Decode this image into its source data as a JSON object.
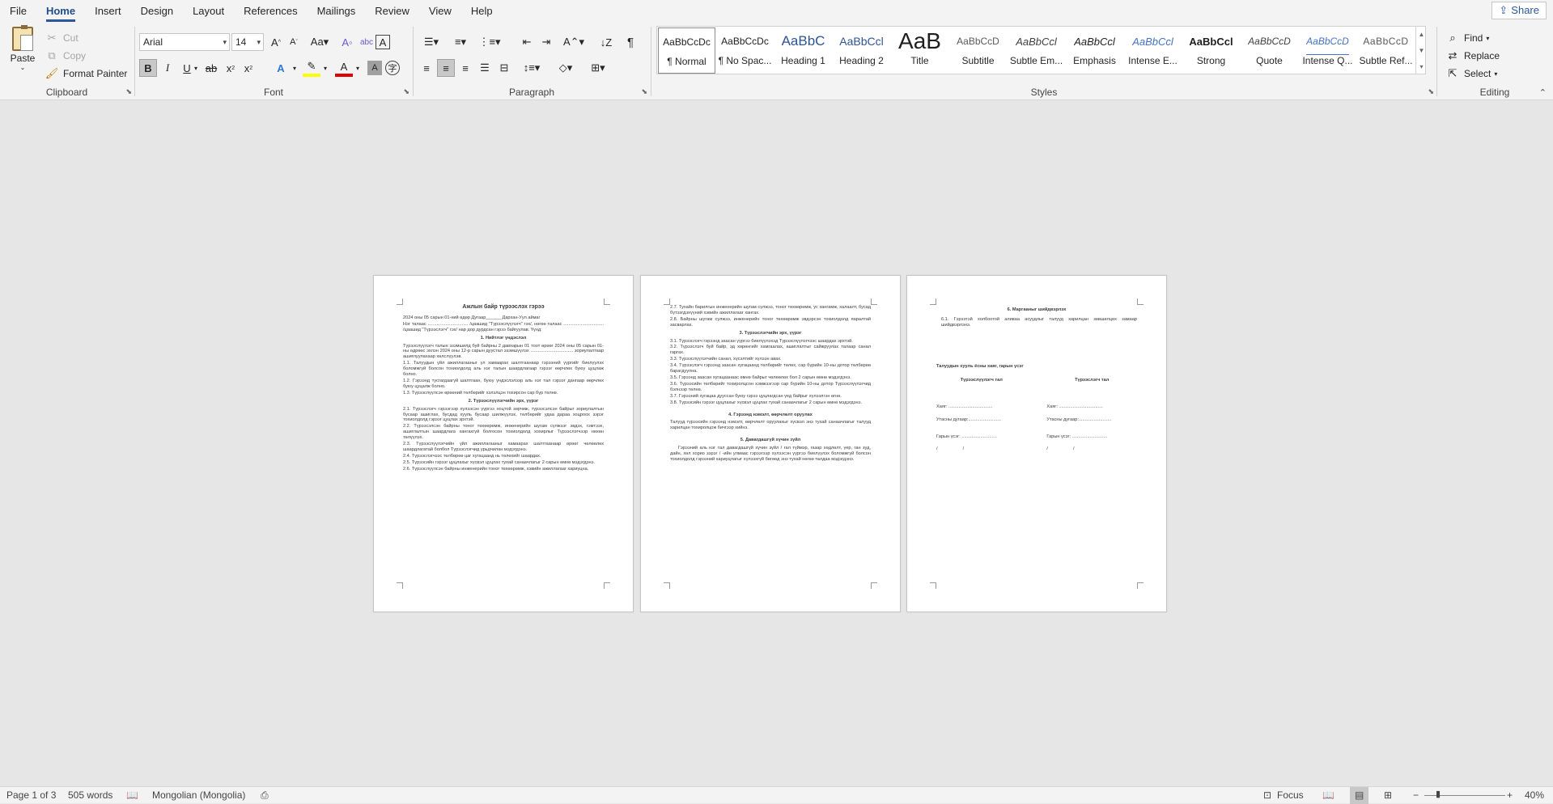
{
  "menu": {
    "tabs": [
      "File",
      "Home",
      "Insert",
      "Design",
      "Layout",
      "References",
      "Mailings",
      "Review",
      "View",
      "Help"
    ],
    "share": "Share"
  },
  "clipboard": {
    "paste": "Paste",
    "cut": "Cut",
    "copy": "Copy",
    "format_painter": "Format Painter",
    "label": "Clipboard"
  },
  "font": {
    "name": "Arial",
    "size": "14",
    "label": "Font"
  },
  "paragraph": {
    "label": "Paragraph"
  },
  "styles": {
    "label": "Styles",
    "items": [
      {
        "preview": "AaBbCcDc",
        "name": "¶ Normal"
      },
      {
        "preview": "AaBbCcDc",
        "name": "¶ No Spac..."
      },
      {
        "preview": "AaBbC",
        "name": "Heading 1"
      },
      {
        "preview": "AaBbCcl",
        "name": "Heading 2"
      },
      {
        "preview": "AaB",
        "name": "Title"
      },
      {
        "preview": "AaBbCcD",
        "name": "Subtitle"
      },
      {
        "preview": "AaBbCcl",
        "name": "Subtle Em..."
      },
      {
        "preview": "AaBbCcl",
        "name": "Emphasis"
      },
      {
        "preview": "AaBbCcl",
        "name": "Intense E..."
      },
      {
        "preview": "AaBbCcl",
        "name": "Strong"
      },
      {
        "preview": "AaBbCcD",
        "name": "Quote"
      },
      {
        "preview": "AaBbCcD",
        "name": "Intense Q..."
      },
      {
        "preview": "AaBbCcD",
        "name": "Subtle Ref..."
      }
    ]
  },
  "editing": {
    "find": "Find",
    "replace": "Replace",
    "select": "Select",
    "label": "Editing"
  },
  "pages": {
    "p1": {
      "title": "Ажлын байр түрээслэх гэрээ",
      "intro": "2024 оны 05 сарын 01-ний өдөр Дугаар______ Дархан-Уул аймаг",
      "para1": "Нэг талаас ................................ /цаашид \"Түрээслүүлэгч\" гэх/, нөгөө талаас ................................ /цаашид \"Түрээслэгч\" гэх/ нар дор дурдсан гэрээ байгуулав. Үүнд:",
      "h1": "1.  Нийтлэг үндэслэл",
      "s1": "Түрээслүүлэгч талын эзэмшилд буй байрны 2 давхарын 01 тоот өрөөг 2024 оны 05 сарын 01-ны өдрөөс эхлэн 2024 оны 12-р сарын дуустал эзэмшүүлэх .................................. зориулалтаар ашиглуулахаар хөлслүүлэв.",
      "s1_1": "1.1.  Талуудын үйл ажиллагааныг үл хамаарах шалтгаанаар гэрээний үүргийг биелүүлэх боломжгүй болсон тохиолдолд аль нэг талын шаардлагаар гэрээг өөрчлөх буюу цуцлаж болно.",
      "s1_2": "1.2.  Гэрээнд тусгагдаагүй шалтгаан, буюу үндэслэлээр аль нэг тал гэрээг дангаар өөрчлөх буюу цуцалж болно.",
      "s1_3": "1.3.  Түрээслүүлсэн өрөөний төлбөрийг хэлэлцэн тохирсон сар бүр төлнө.",
      "h2": "2.  Түрээслүүлэгчийн эрх, үүрэг",
      "s2_1": "2.1.  Түрээслэгч гэрээгээр хүлээсэн үүргээ ноцтой зөрчиж, түрээсэлсэн байрыг зориулалтын бусаар ашиглах, бусдад хууль бусаар шилжүүлэх, төлбөрийг удаа дараа хоцроох зэрэг тохиолдолд гэрээг цуцлах эрхтэй.",
      "s2_2": "2.2.  Түрээсэлсэн байрны тоног төхөөрөмж, инженерийн шугам сүлжээг эвдэх, гэмтээх, ашиглалтын шаардлага хангахгүй болгосон тохиолдолд хохирлыг Түрээслэгчээр нөхөн төлүүлэх.",
      "s2_3": "2.3.  Түрээслүүлэгчийн үйл ажиллагааныг хамаарах шалтгаанаар өрөөг чөлөөлөх шаардлагатай болбол Түрээслэгчид урьдчилан мэдэгдэнэ.",
      "s2_4": "2.4.  Түрээслэгчээс төлбөрөө цаг хугацаанд нь төлөхийг шаардах.",
      "s2_5": "2.5.  Түрээсийн гэрээг цуцлахыг хүсвэл цуцлах тухай санаачлагыг 2 сарын өмнө мэдэгдэнэ.",
      "s2_6": "2.6.  Түрээслүүлсэн байрны инженерийн тоног төхөөрөмж, хэвийн ажиллагааг хариуцна."
    },
    "p2": {
      "s2_7": "2.7. Тухайн барилгын инженерийн шугам сүлжээ, тоног төхөөрөмж, ус хангамж, халаалт, бусад бүтээгдэхүүний хэвийн ажиллагааг хангах.",
      "s2_8": "2.8. Байрны шугам сүлжээ, инженерийн тоног төхөөрөмж эвдэрсэн тохиолдолд яаралтай засварлах.",
      "h3": "3.  Түрээслэгчийн эрх, үүрэг",
      "s3_1": "3.1. Түрээслэгч гэрээнд заасан үүргээ биелүүлэхэд Түрээслүүлэгчээс шаардах эрхтэй.",
      "s3_2": "3.2. Түрээслэгч буй байр, эд хөрөнгийг хамгаалах, ашиглалтыг сайжруулах талаар санал гаргах.",
      "s3_3": "3.3. Түрээслүүлэгчийн санал, хүсэлтийг хүлээн авах.",
      "s3_4": "3.4. Түрээслэгч гэрээнд заасан хугацаанд төлбөрийг төлөх, сар бүрийн 10-ны дотор төлбөрөө барагдуулна.",
      "s3_5": "3.5. Гэрээнд заасан хугацаанаас өмнө байрыг чөлөөлөх бол 2 сарын өмнө мэдэгдэнэ.",
      "s3_6": "3.6. Түрээсийн төлбөрийг тохиролцсон хэмжээгээр сар бүрийн 10-ны дотор Түрээслүүлэгчид бэлнээр төлнө.",
      "s3_7": "3.7. Гэрээний хугацаа дууссан буюу гэрээ цуцлагдсан үед байрыг хүлээлгэн өгнө.",
      "s3_8": "3.8. Түрээсийн гэрээг цуцлахыг хүсвэл цуцлах тухай санаачлагыг 2 сарын өмнө мэдэгдэнэ.",
      "h4": "4.  Гэрээнд нэмэлт, өөрчлөлт оруулах",
      "s4": "Талууд түрээсийн гэрээнд нэмэлт, өөрчлөлт оруулахыг хүсвэл энэ тухай санаачлагыг талууд харилцан тохиролцож бичгээр хийнэ.",
      "h5": "5.  Давагдашгүй хүчин зүйл",
      "s5": "Гэрээний аль нэг тал давагдашгүй хүчин зүйл / гал түймэр, газар хөдлөлт, үер, ган зуд, дайн, хөл хорио зэрэг / -ийн улмаас гэрээгээр хүлээсэн үүргээ биелүүлэх боломжгүй болсон тохиолдолд гэрээний хариуцлагыг хүлээхгүй бөгөөд энэ тухай нөгөө талдаа мэдэгдэнэ."
    },
    "p3": {
      "h6": "6.  Маргааныг шийдвэрлэх",
      "s6": "6.1. Гэрээтэй холбоотой аливаа асуудлыг талууд харилцан зөвшилцөх замаар шийдвэрлэнэ.",
      "sig_title": "Талуудын хууль ёсны хаяг, гарын үсэг",
      "col1": "Түрээслүүлэгч тал",
      "col2": "Түрээслэгч тал",
      "addr1": "Хаяг: ...................................",
      "phone1": "Утасны дугаар:..........................",
      "sign1": "Гарын үсэг: ............................",
      "slash1": "/                    /",
      "addr2": "Хаяг: ...................................",
      "phone2": "Утасны дугаар:..........................",
      "sign2": "Гарын үсэг: ............................",
      "slash2": "/                    /"
    }
  },
  "status": {
    "page": "Page 1 of 3",
    "words": "505 words",
    "language": "Mongolian (Mongolia)",
    "focus": "Focus",
    "zoom": "40%"
  }
}
